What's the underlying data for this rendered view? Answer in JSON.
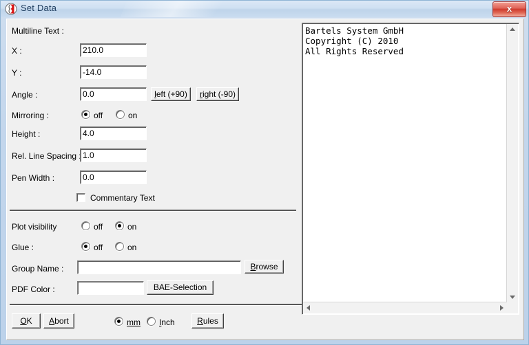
{
  "window": {
    "title": "Set Data",
    "icon": "app-logo-icon",
    "close_label": "x",
    "colors": {
      "frame": "#bcd2ea",
      "titlebar": "#cfe0f2",
      "client": "#f0f0f0",
      "close_button": "#cf3b2e",
      "title_text": "#1d3c5e",
      "separator": "#585858"
    }
  },
  "form": {
    "multiline_label": "Multiline Text :",
    "fields": [
      {
        "label": "X :",
        "value": "210.0"
      },
      {
        "label": "Y :",
        "value": "-14.0"
      },
      {
        "label": "Angle :",
        "value": "0.0"
      },
      {
        "label": "Height :",
        "value": "4.0"
      },
      {
        "label": "Rel. Line Spacing :",
        "value": "1.0"
      },
      {
        "label": "Pen Width :",
        "value": "0.0"
      }
    ],
    "angle_buttons": [
      {
        "label": "left (+90)",
        "mnemonic": "l"
      },
      {
        "label": "right (-90)",
        "mnemonic": "r"
      }
    ],
    "mirroring": {
      "label": "Mirroring :",
      "options": [
        "off",
        "on"
      ],
      "selected": "off"
    },
    "commentary": {
      "label": "Commentary Text",
      "checked": false
    },
    "plot_visibility": {
      "label": "Plot visibility",
      "options": [
        "off",
        "on"
      ],
      "selected": "on"
    },
    "glue": {
      "label": "Glue :",
      "options": [
        "off",
        "on"
      ],
      "selected": "off"
    },
    "group_name": {
      "label": "Group Name :",
      "value": "",
      "browse_label": "Browse",
      "browse_mnemonic": "B"
    },
    "pdf_color": {
      "label": "PDF Color :",
      "value": "",
      "selection_label": "BAE-Selection"
    }
  },
  "text_panel": {
    "content": "Bartels System GmbH\nCopyright (C) 2010\nAll Rights Reserved",
    "scroll_up": "scrollbar-up-arrow",
    "scroll_down": "scrollbar-down-arrow",
    "scroll_left": "scrollbar-left-arrow",
    "scroll_right": "scrollbar-right-arrow"
  },
  "footer": {
    "ok_label": "OK",
    "ok_mnemonic": "O",
    "abort_label": "Abort",
    "abort_mnemonic": "A",
    "units": {
      "options": [
        "mm",
        "Inch"
      ],
      "selected": "mm"
    },
    "rules_label": "Rules",
    "rules_mnemonic": "R"
  }
}
